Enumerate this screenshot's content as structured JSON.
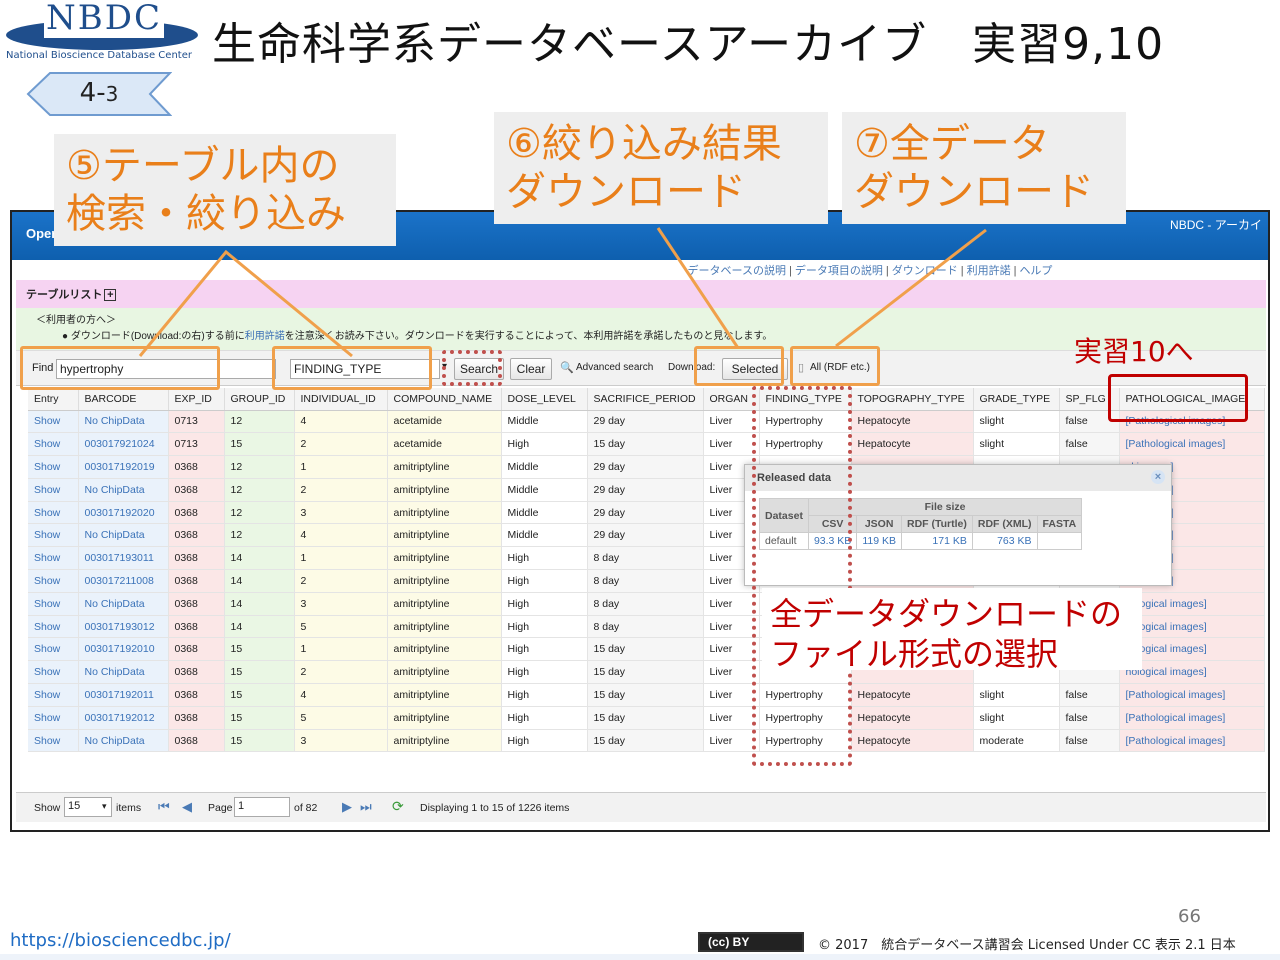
{
  "header": {
    "logo_text": "NBDC",
    "logo_sub": "National Bioscience Database Center",
    "title": "生命科学系データベースアーカイブ　実習9,10",
    "section_main": "4-",
    "section_sub": "3"
  },
  "app": {
    "brand": "Oper",
    "top_right": "NBDC - アーカイ",
    "nav": [
      "データベースの説明",
      "データ項目の説明",
      "ダウンロード",
      "利用許諾",
      "ヘルプ"
    ],
    "table_list": "テーブルリスト",
    "notice_line1": "＜利用者の方へ＞",
    "notice_line2_pre": "●  ダウンロード(Download:の右)する前に",
    "notice_line2_link": "利用許諾",
    "notice_line2_post": "を注意深くお読み下さい。ダウンロードを実行することによって、本利用許諾を承諾したものと見なします。",
    "toolbar": {
      "find_label": "Find",
      "find_value": "hypertrophy",
      "field_value": "FINDING_TYPE",
      "search": "Search",
      "clear": "Clear",
      "advanced": "Advanced search",
      "download_label": "Download:",
      "selected": "Selected",
      "all": "All (RDF etc.)"
    },
    "columns": [
      "Entry",
      "BARCODE",
      "EXP_ID",
      "GROUP_ID",
      "INDIVIDUAL_ID",
      "COMPOUND_NAME",
      "DOSE_LEVEL",
      "SACRIFICE_PERIOD",
      "ORGAN",
      "FINDING_TYPE",
      "TOPOGRAPHY_TYPE",
      "GRADE_TYPE",
      "SP_FLG",
      "PATHOLOGICAL_IMAGE"
    ],
    "rows": [
      [
        "Show",
        "No ChipData",
        "0713",
        "12",
        "4",
        "acetamide",
        "Middle",
        "29 day",
        "Liver",
        "Hypertrophy",
        "Hepatocyte",
        "slight",
        "false",
        "[Pathological images]"
      ],
      [
        "Show",
        "003017921024",
        "0713",
        "15",
        "2",
        "acetamide",
        "High",
        "15 day",
        "Liver",
        "Hypertrophy",
        "Hepatocyte",
        "slight",
        "false",
        "[Pathological images]"
      ],
      [
        "Show",
        "003017192019",
        "0368",
        "12",
        "1",
        "amitriptyline",
        "Middle",
        "29 day",
        "Liver",
        "",
        "",
        "",
        "",
        "al images]"
      ],
      [
        "Show",
        "No ChipData",
        "0368",
        "12",
        "2",
        "amitriptyline",
        "Middle",
        "29 day",
        "Liver",
        "",
        "",
        "",
        "",
        "al images]"
      ],
      [
        "Show",
        "003017192020",
        "0368",
        "12",
        "3",
        "amitriptyline",
        "Middle",
        "29 day",
        "Liver",
        "",
        "",
        "",
        "",
        "al images]"
      ],
      [
        "Show",
        "No ChipData",
        "0368",
        "12",
        "4",
        "amitriptyline",
        "Middle",
        "29 day",
        "Liver",
        "",
        "",
        "",
        "",
        "al images]"
      ],
      [
        "Show",
        "003017193011",
        "0368",
        "14",
        "1",
        "amitriptyline",
        "High",
        "8 day",
        "Liver",
        "",
        "",
        "",
        "",
        "al images]"
      ],
      [
        "Show",
        "003017211008",
        "0368",
        "14",
        "2",
        "amitriptyline",
        "High",
        "8 day",
        "Liver",
        "",
        "",
        "",
        "",
        "al images]"
      ],
      [
        "Show",
        "No ChipData",
        "0368",
        "14",
        "3",
        "amitriptyline",
        "High",
        "8 day",
        "Liver",
        "",
        "",
        "",
        "",
        "hological images]"
      ],
      [
        "Show",
        "003017193012",
        "0368",
        "14",
        "5",
        "amitriptyline",
        "High",
        "8 day",
        "Liver",
        "",
        "",
        "",
        "",
        "hological images]"
      ],
      [
        "Show",
        "003017192010",
        "0368",
        "15",
        "1",
        "amitriptyline",
        "High",
        "15 day",
        "Liver",
        "",
        "",
        "",
        "",
        "hological images]"
      ],
      [
        "Show",
        "No ChipData",
        "0368",
        "15",
        "2",
        "amitriptyline",
        "High",
        "15 day",
        "Liver",
        "",
        "",
        "",
        "",
        "hological images]"
      ],
      [
        "Show",
        "003017192011",
        "0368",
        "15",
        "4",
        "amitriptyline",
        "High",
        "15 day",
        "Liver",
        "Hypertrophy",
        "Hepatocyte",
        "slight",
        "false",
        "[Pathological images]"
      ],
      [
        "Show",
        "003017192012",
        "0368",
        "15",
        "5",
        "amitriptyline",
        "High",
        "15 day",
        "Liver",
        "Hypertrophy",
        "Hepatocyte",
        "slight",
        "false",
        "[Pathological images]"
      ],
      [
        "Show",
        "No ChipData",
        "0368",
        "15",
        "3",
        "amitriptyline",
        "High",
        "15 day",
        "Liver",
        "Hypertrophy",
        "Hepatocyte",
        "moderate",
        "false",
        "[Pathological images]"
      ]
    ],
    "pager": {
      "show_label": "Show",
      "show_value": "15",
      "items_label": "items",
      "page_label": "Page",
      "page_value": "1",
      "of_pages": "of 82",
      "displaying": "Displaying 1 to 15 of 1226 items"
    },
    "popup": {
      "title": "Released data",
      "close": "×",
      "dataset_header": "Dataset",
      "filesize_header": "File size",
      "format_headers": [
        "CSV",
        "JSON",
        "RDF (Turtle)",
        "RDF (XML)",
        "FASTA"
      ],
      "dataset_name": "default",
      "sizes": [
        "93.3 KB",
        "119 KB",
        "171 KB",
        "763 KB",
        ""
      ]
    }
  },
  "annotations": {
    "callout5": [
      "⑤テーブル内の",
      "検索・絞り込み"
    ],
    "callout6": [
      "⑥絞り込み結果",
      "ダウンロード"
    ],
    "callout7": [
      "⑦全データ",
      "ダウンロード"
    ],
    "practice10": "実習10へ",
    "format_note": [
      "全データダウンロードの",
      "ファイル形式の選択"
    ]
  },
  "footer": {
    "page_number": "66",
    "url": "https://biosciencedbc.jp/",
    "cc_badge": "(cc) BY",
    "license": "© 2017　統合データベース講習会 Licensed Under CC 表示 2.1 日本"
  },
  "colors": {
    "callout_text": "#e97f1a",
    "highlight_red": "#c00000",
    "header_blue": "#0e5fae",
    "row_colors": [
      "#eaf2fb",
      "#fbe7e7",
      "#eaf7e4",
      "#fdfbe6",
      "#fff"
    ]
  }
}
